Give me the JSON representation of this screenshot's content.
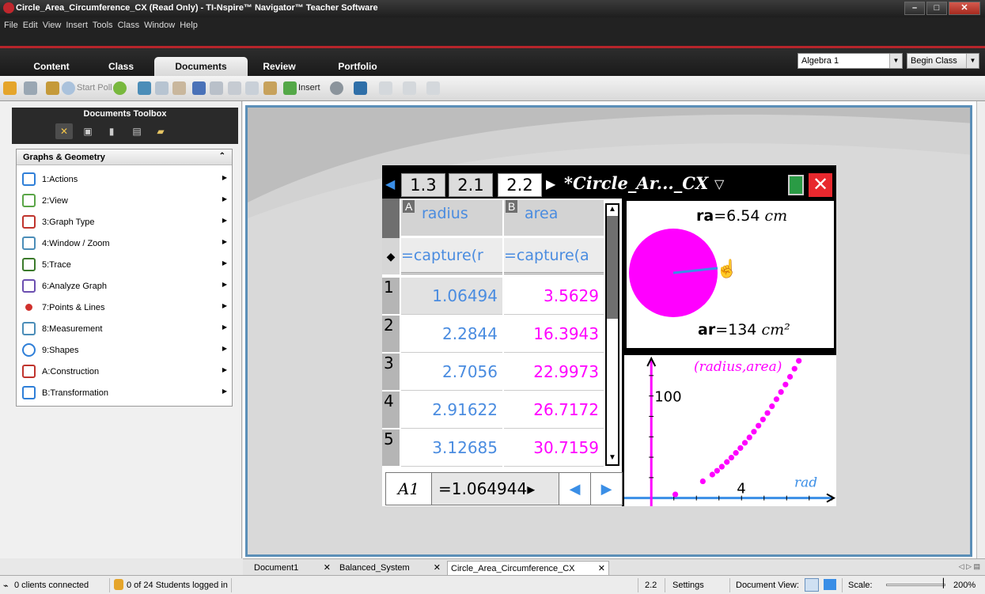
{
  "window": {
    "title": "Circle_Area_Circumference_CX (Read Only) - TI-Nspire™ Navigator™ Teacher Software",
    "buttons": [
      "–",
      "□",
      "✕"
    ]
  },
  "menu": [
    "File",
    "Edit",
    "View",
    "Insert",
    "Tools",
    "Class",
    "Window",
    "Help"
  ],
  "tabs": [
    {
      "label": "Content"
    },
    {
      "label": "Class"
    },
    {
      "label": "Documents",
      "active": true
    },
    {
      "label": "Review"
    },
    {
      "label": "Portfolio"
    }
  ],
  "class_select": {
    "value": "Algebra 1"
  },
  "begin_class": "Begin Class",
  "toolbar": {
    "start_poll": "Start Poll",
    "insert": "Insert"
  },
  "toolbox": {
    "title": "Documents Toolbox",
    "section": "Graphs & Geometry",
    "items": [
      {
        "label": "1:Actions",
        "icon": "pointer-icon"
      },
      {
        "label": "2:View",
        "icon": "view-icon"
      },
      {
        "label": "3:Graph Type",
        "icon": "graph-type-icon"
      },
      {
        "label": "4:Window / Zoom",
        "icon": "window-zoom-icon"
      },
      {
        "label": "5:Trace",
        "icon": "trace-icon"
      },
      {
        "label": "6:Analyze Graph",
        "icon": "analyze-graph-icon"
      },
      {
        "label": "7:Points & Lines",
        "icon": "point-icon"
      },
      {
        "label": "8:Measurement",
        "icon": "ruler-icon"
      },
      {
        "label": "9:Shapes",
        "icon": "circle-icon"
      },
      {
        "label": "A:Construction",
        "icon": "construction-icon"
      },
      {
        "label": "B:Transformation",
        "icon": "transformation-icon"
      }
    ]
  },
  "handheld": {
    "page_tabs": [
      "1.3",
      "2.1",
      "2.2"
    ],
    "active_tab": "2.2",
    "doc_title": "*Circle_Ar..._CX",
    "lists": {
      "col_a_letter": "A",
      "col_a_name": "radius",
      "col_a_formula": "=capture(r",
      "col_b_letter": "B",
      "col_b_name": "area",
      "col_b_formula": "=capture(a",
      "rows": [
        {
          "n": "1",
          "radius": "1.06494",
          "area": "3.5629"
        },
        {
          "n": "2",
          "radius": "2.2844",
          "area": "16.3943"
        },
        {
          "n": "3",
          "radius": "2.7056",
          "area": "22.9973"
        },
        {
          "n": "4",
          "radius": "2.91622",
          "area": "26.7172"
        },
        {
          "n": "5",
          "radius": "3.12685",
          "area": "30.7159"
        }
      ],
      "cell_ref": "A1",
      "cell_value": "=1.064944▸"
    },
    "geometry": {
      "ra_label": "ra",
      "ra_value": "=6.54",
      "ra_unit": "cm",
      "ar_label": "ar",
      "ar_value": "=134",
      "ar_unit": "cm²"
    },
    "graph": {
      "plot_label": "(radius,area)",
      "y_tick": "100",
      "x_tick": "4",
      "x_label": "rad"
    }
  },
  "chart_data": {
    "type": "scatter",
    "title": "(radius,area)",
    "xlabel": "rad",
    "ylabel": "",
    "series": [
      {
        "name": "(radius,area)",
        "x": [
          1.06494,
          2.2844,
          2.7056,
          2.91622,
          3.12685,
          3.35,
          3.55,
          3.75,
          3.95,
          4.15,
          4.35,
          4.55,
          4.75,
          4.95,
          5.15,
          5.35,
          5.55,
          5.75,
          5.95,
          6.15,
          6.35,
          6.54
        ],
        "y": [
          3.5629,
          16.3943,
          22.9973,
          26.7172,
          30.7159,
          35.3,
          39.6,
          44.2,
          49.0,
          54.1,
          59.4,
          65.0,
          70.9,
          77.0,
          83.3,
          89.9,
          96.8,
          103.9,
          111.2,
          118.8,
          126.7,
          134.4
        ]
      }
    ],
    "xlim": [
      -1.2,
      8.2
    ],
    "ylim": [
      -8,
      140
    ]
  },
  "doc_tabs": [
    {
      "label": "Document1"
    },
    {
      "label": "Balanced_System"
    },
    {
      "label": "Circle_Area_Circumference_CX",
      "active": true
    }
  ],
  "status": {
    "clients": "0 clients connected",
    "students": "0 of 24 Students logged in",
    "page": "2.2",
    "settings": "Settings",
    "doc_view": "Document View:",
    "scale": "Scale:",
    "zoom": "200%"
  },
  "colors": {
    "accent_red": "#b7252b",
    "frame_blue": "#5b8fb8",
    "data_blue": "#4a8ce0",
    "data_magenta": "#ff00ff"
  }
}
